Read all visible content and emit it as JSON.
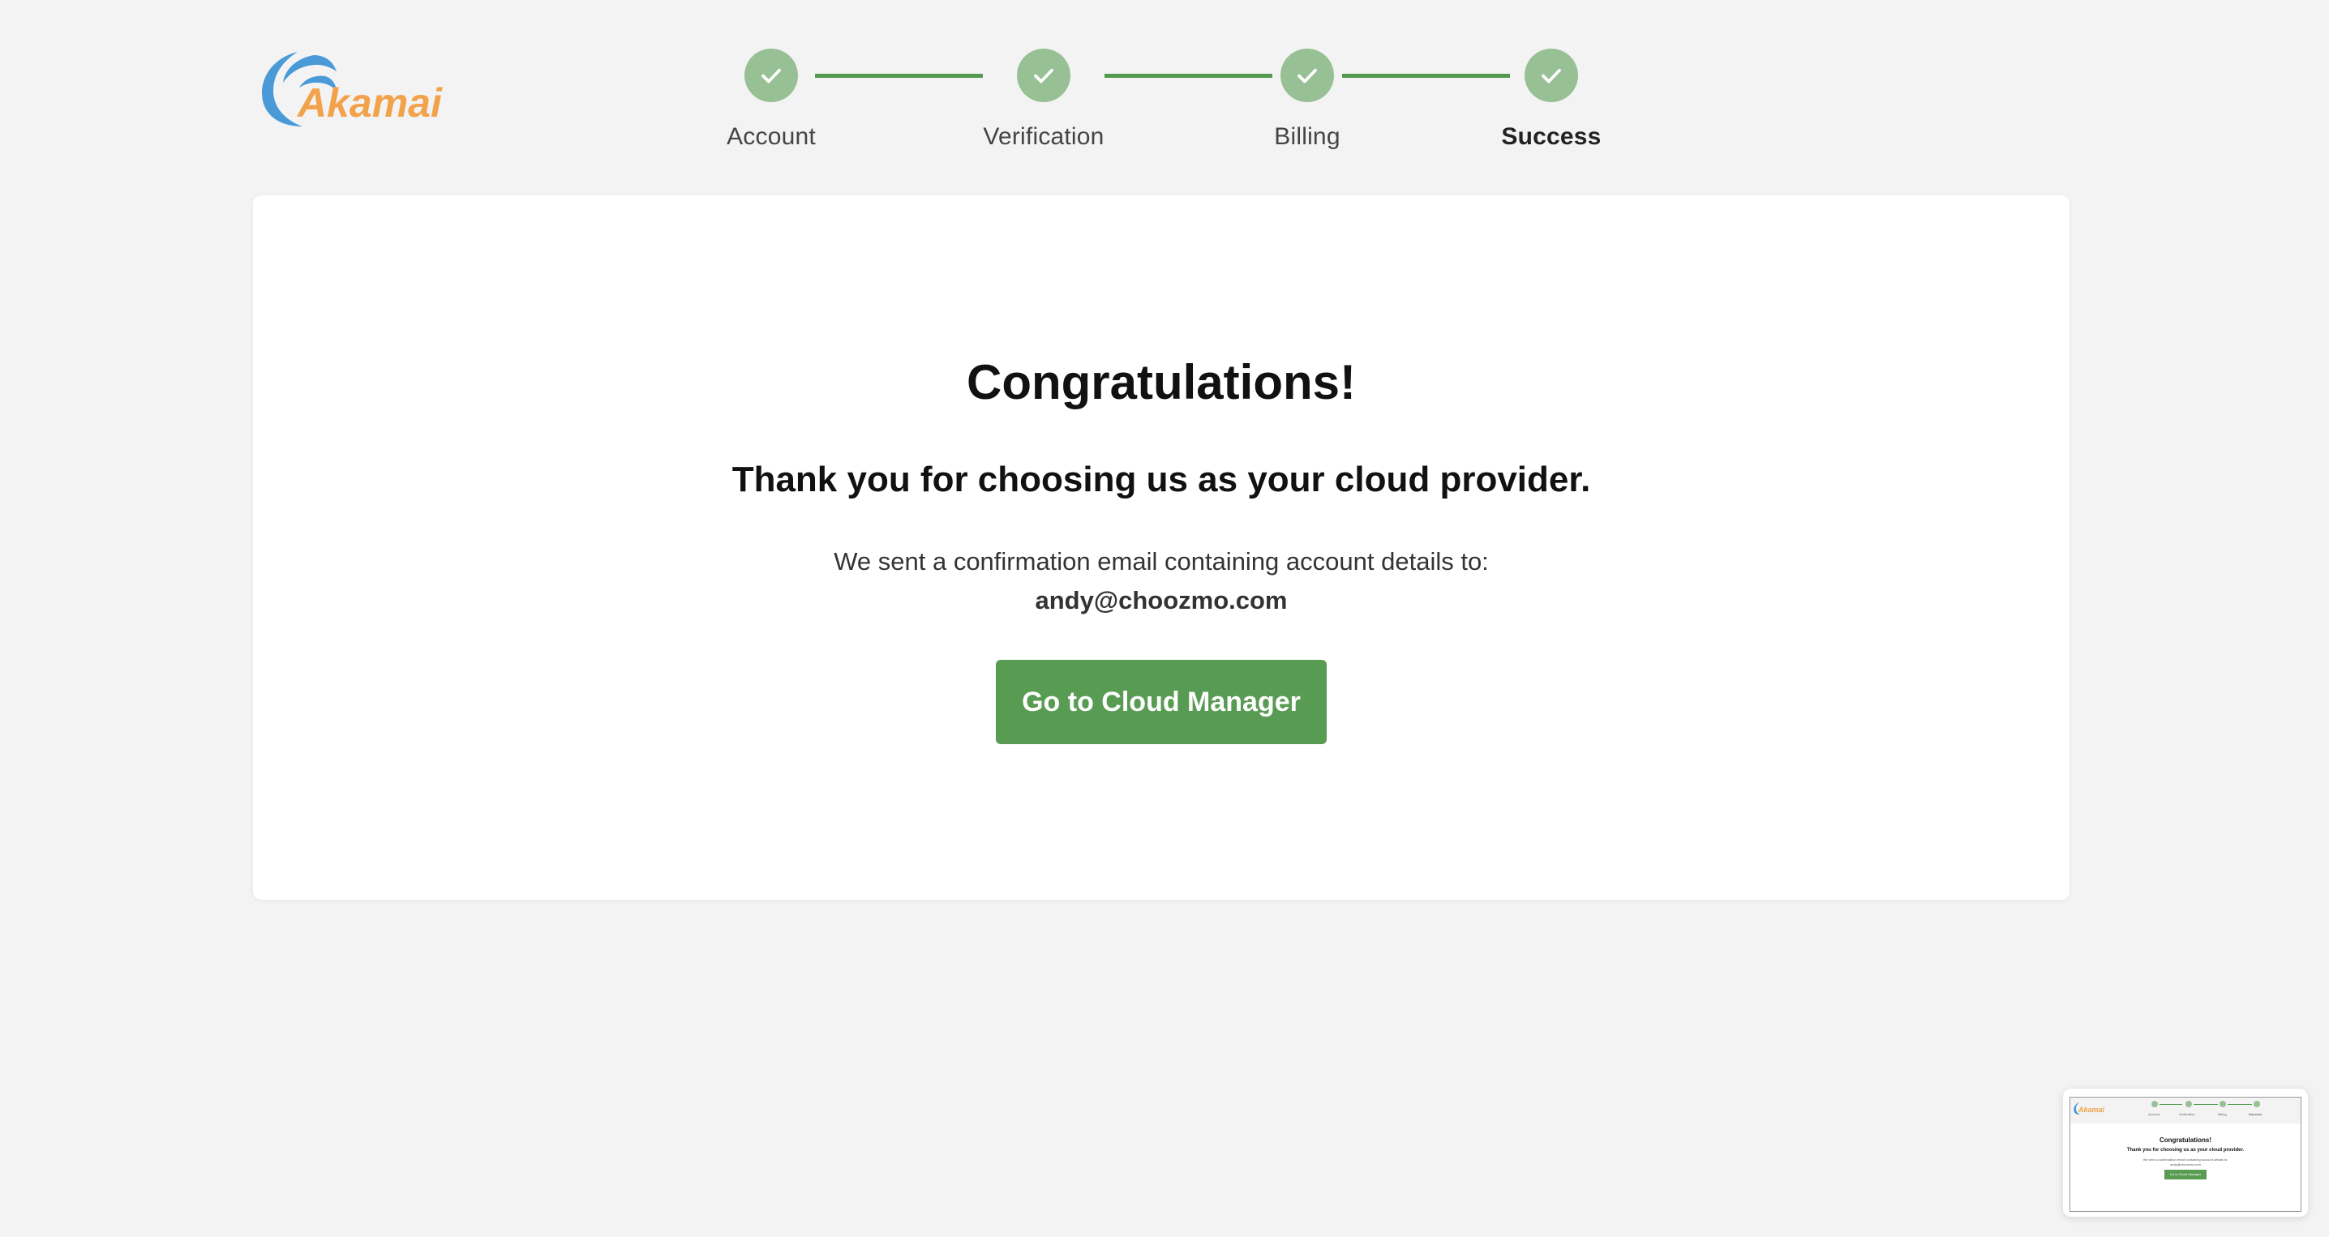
{
  "brand": {
    "name": "Akamai",
    "logo_wave_color": "#4a9ad8",
    "logo_text_color": "#f2a24a"
  },
  "stepper": {
    "steps": [
      {
        "label": "Account",
        "status": "complete"
      },
      {
        "label": "Verification",
        "status": "complete"
      },
      {
        "label": "Billing",
        "status": "complete"
      },
      {
        "label": "Success",
        "status": "complete",
        "current": true
      }
    ],
    "complete_color": "#98c095",
    "connector_color": "#549a4e"
  },
  "success": {
    "title": "Congratulations!",
    "subtitle": "Thank you for choosing us as your cloud provider.",
    "sent_text": "We sent a confirmation email containing account details to:",
    "email": "andy@choozmo.com",
    "cta_label": "Go to Cloud Manager",
    "cta_color": "#589b52"
  },
  "thumbnail": {
    "brand": "Akamai",
    "steps": [
      "Account",
      "Verification",
      "Billing",
      "Success"
    ],
    "title": "Congratulations!",
    "subtitle": "Thank you for choosing us as your cloud provider.",
    "sent_text": "We sent a confirmation email containing account details to:",
    "email": "andy@choozmo.com",
    "cta_label": "Go to Cloud Manager"
  }
}
